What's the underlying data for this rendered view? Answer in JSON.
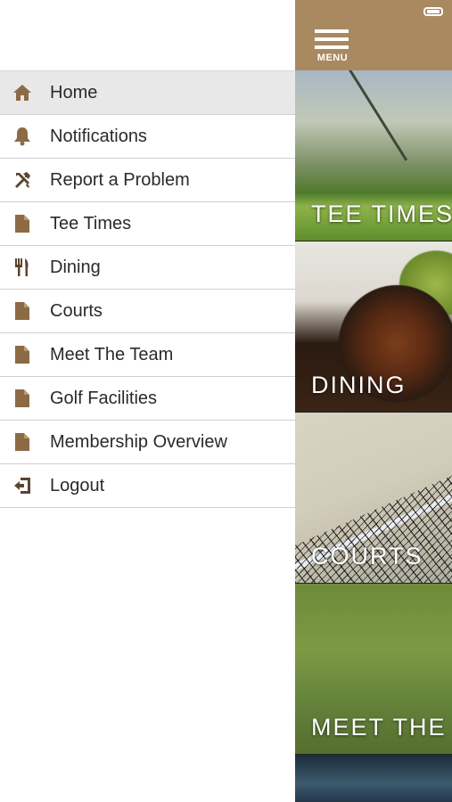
{
  "drawer": {
    "items": [
      {
        "label": "Home",
        "icon": "home-icon",
        "active": true
      },
      {
        "label": "Notifications",
        "icon": "bell-icon",
        "active": false
      },
      {
        "label": "Report a Problem",
        "icon": "tools-icon",
        "active": false
      },
      {
        "label": "Tee Times",
        "icon": "document-icon",
        "active": false
      },
      {
        "label": "Dining",
        "icon": "utensils-icon",
        "active": false
      },
      {
        "label": "Courts",
        "icon": "document-icon",
        "active": false
      },
      {
        "label": "Meet The Team",
        "icon": "document-icon",
        "active": false
      },
      {
        "label": "Golf Facilities",
        "icon": "document-icon",
        "active": false
      },
      {
        "label": "Membership Overview",
        "icon": "document-icon",
        "active": false
      },
      {
        "label": "Logout",
        "icon": "logout-icon",
        "active": false
      }
    ]
  },
  "header": {
    "menu_label": "MENU"
  },
  "tiles": [
    {
      "label": "TEE TIMES"
    },
    {
      "label": "DINING"
    },
    {
      "label": "COURTS"
    },
    {
      "label": "MEET THE"
    },
    {
      "label": ""
    }
  ],
  "colors": {
    "accent": "#a9895f",
    "icon": "#8b6a45",
    "active_row": "#e8e8e8"
  }
}
